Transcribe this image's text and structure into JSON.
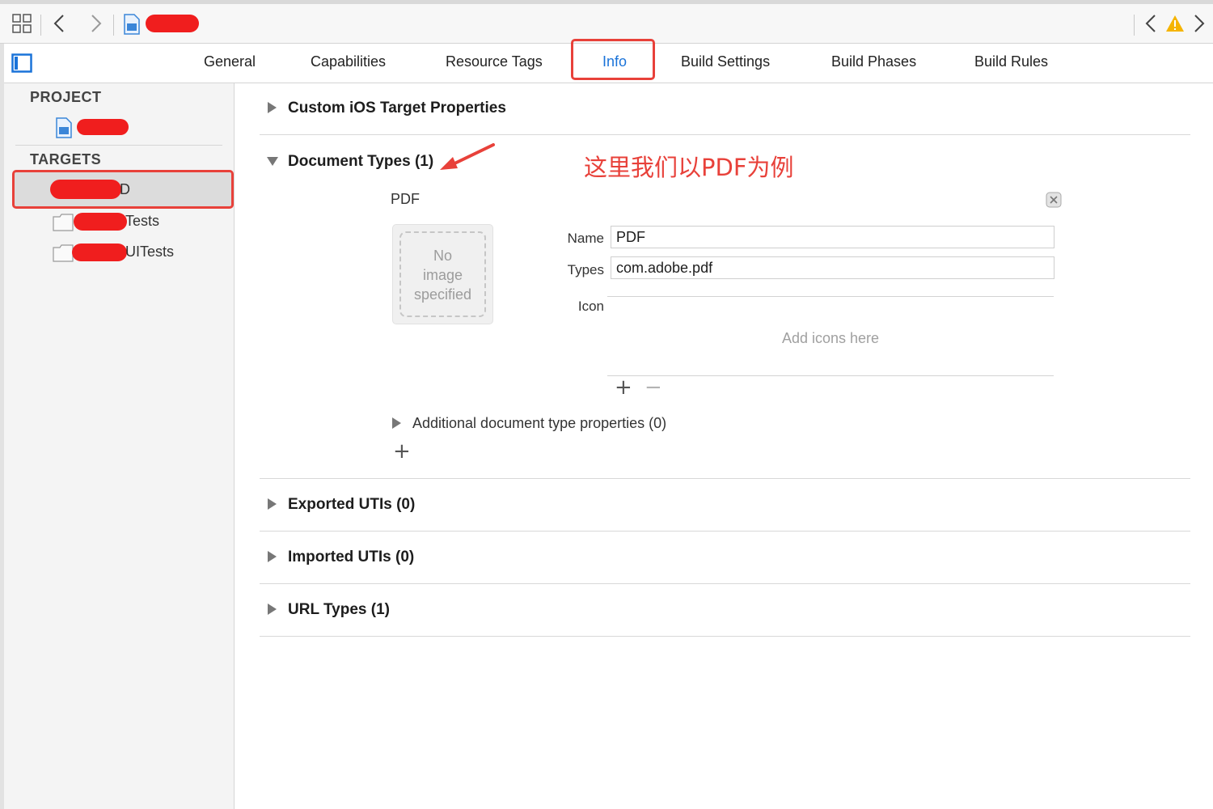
{
  "toolbar": {
    "grid_icon": "grid-icon",
    "back_icon": "chevron-left-icon",
    "forward_icon": "chevron-right-icon",
    "file_icon": "project-file-icon",
    "right_back_icon": "chevron-left-icon",
    "warning_icon": "warning-icon",
    "right_forward_icon": "chevron-right-icon",
    "warning_color": "#f5b400"
  },
  "tabs": [
    {
      "label": "General"
    },
    {
      "label": "Capabilities"
    },
    {
      "label": "Resource Tags"
    },
    {
      "label": "Info"
    },
    {
      "label": "Build Settings"
    },
    {
      "label": "Build Phases"
    },
    {
      "label": "Build Rules"
    }
  ],
  "active_tab": "Info",
  "accent_color": "#1a73d9",
  "annotation_color": "#e8413a",
  "sidebar": {
    "project_header": "PROJECT",
    "targets_header": "TARGETS",
    "target_items": [
      {
        "suffix": "D"
      },
      {
        "suffix": "Tests"
      },
      {
        "suffix": "UITests"
      }
    ]
  },
  "main": {
    "custom_props": "Custom iOS Target Properties",
    "document_types": "Document Types (1)",
    "annotation": "这里我们以PDF为例",
    "doc": {
      "title": "PDF",
      "image_placeholder": [
        "No",
        "image",
        "specified"
      ],
      "name_label": "Name",
      "name_value": "PDF",
      "types_label": "Types",
      "types_value": "com.adobe.pdf",
      "icon_label": "Icon",
      "icons_placeholder": "Add icons here",
      "additional_props": "Additional document type properties (0)"
    },
    "exported_utis": "Exported UTIs (0)",
    "imported_utis": "Imported UTIs (0)",
    "url_types": "URL Types (1)"
  }
}
